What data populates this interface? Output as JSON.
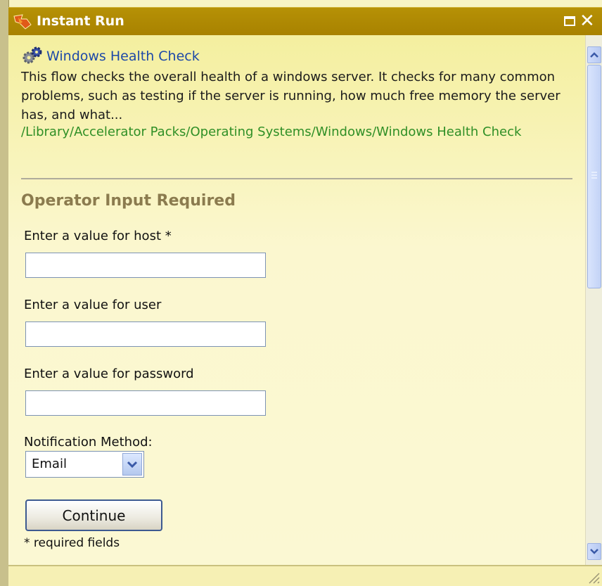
{
  "window": {
    "title": "Instant Run",
    "maximize_icon": "maximize-icon",
    "close_icon": "close-icon"
  },
  "flow": {
    "icon": "gear-icon",
    "name": "Windows Health Check",
    "description": "This flow checks the overall health of a windows server. It checks for many common problems, such as testing if the server is running, how much free memory the server has, and what...",
    "path": "/Library/Accelerator Packs/Operating Systems/Windows/Windows Health Check"
  },
  "form": {
    "section_title": "Operator Input Required",
    "host_label": "Enter a value for host *",
    "host_value": "",
    "user_label": "Enter a value for user",
    "user_value": "",
    "password_label": "Enter a value for password",
    "password_value": "",
    "notification_label": "Notification Method:",
    "notification_selected": "Email",
    "continue_label": "Continue",
    "required_note": "* required fields"
  },
  "colors": {
    "titlebar": "#a88200",
    "panel_background": "#f8f4c4",
    "link": "#1d49a8",
    "path": "#2f8f26",
    "section_title": "#8b7b4e"
  }
}
